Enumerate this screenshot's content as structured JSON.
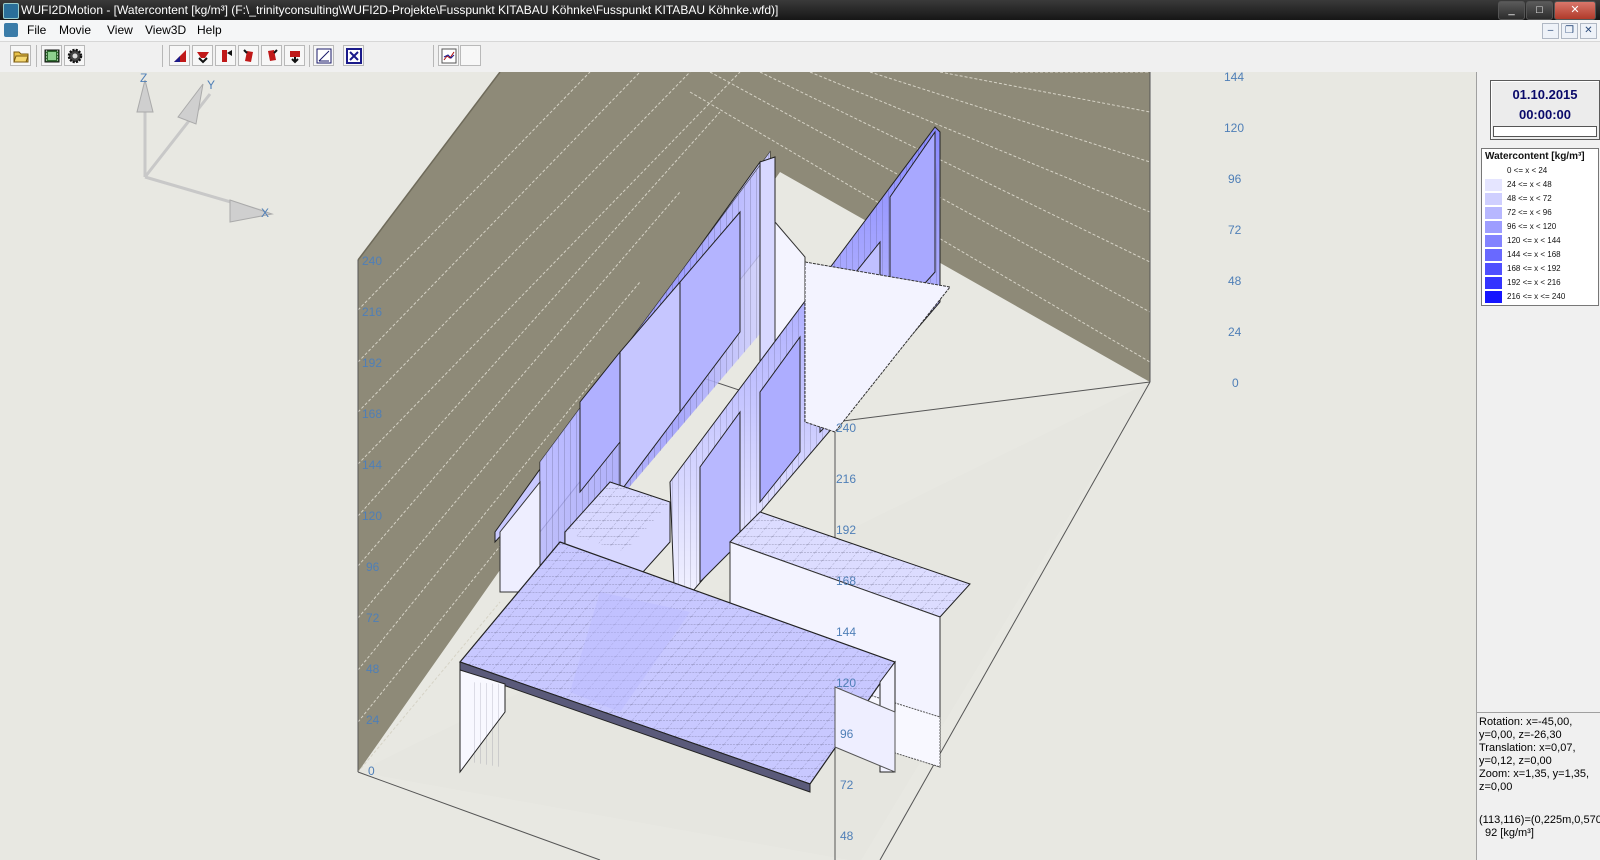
{
  "window": {
    "title": "WUFI2DMotion - [Watercontent [kg/m³] (F:\\_trinityconsulting\\WUFI2D-Projekte\\Fusspunkt KITABAU Köhnke\\Fusspunkt KITABAU Köhnke.wfd)]",
    "minimize": "_",
    "maximize": "□",
    "close": "✕"
  },
  "menu": [
    {
      "label": "File"
    },
    {
      "label": "Movie"
    },
    {
      "label": "View"
    },
    {
      "label": "View3D"
    },
    {
      "label": "Help"
    }
  ],
  "mdi": {
    "minimize": "–",
    "restore": "❐",
    "close": "✕"
  },
  "toolbar": [
    {
      "icon": "folder-open-icon"
    },
    {
      "icon": "film-icon"
    },
    {
      "icon": "gear-icon"
    },
    {
      "icon": "rotate-x-icon"
    },
    {
      "icon": "rotate-y-icon"
    },
    {
      "icon": "rotate-z-icon"
    },
    {
      "icon": "tilt-left-icon"
    },
    {
      "icon": "tilt-right-icon"
    },
    {
      "icon": "tilt-down-icon"
    },
    {
      "icon": "perspective-icon"
    },
    {
      "icon": "fit-view-icon"
    },
    {
      "icon": "chart-icon"
    }
  ],
  "viewport": {
    "axes": {
      "z": "Z",
      "y": "Y",
      "x": "X"
    },
    "left_axis_ticks": [
      "0",
      "24",
      "48",
      "72",
      "96",
      "120",
      "144",
      "168",
      "192",
      "216",
      "240"
    ],
    "right_axis_ticks": [
      "0",
      "24",
      "48",
      "72",
      "96",
      "120",
      "144"
    ],
    "front_axis_ticks": [
      "48",
      "72",
      "96",
      "120",
      "144",
      "168",
      "192",
      "216",
      "240"
    ],
    "colors": {
      "background": "#e8e8e2",
      "wall": "#8e8a78",
      "gridline": "#d6d3c6",
      "mesh_dark": "#333344",
      "mesh_fill": "#9f9fff",
      "ticks": "#4f7fb7"
    }
  },
  "clock": {
    "date": "01.10.2015",
    "time": "00:00:00",
    "progress": 0.0
  },
  "legend": {
    "title": "Watercontent [kg/m³]",
    "items": [
      {
        "label": "0 <= x < 24",
        "color": "#ffffff"
      },
      {
        "label": "24 <= x < 48",
        "color": "#e5e5ff"
      },
      {
        "label": "48 <= x < 72",
        "color": "#cfcfff"
      },
      {
        "label": "72 <= x < 96",
        "color": "#b7b7ff"
      },
      {
        "label": "96 <= x < 120",
        "color": "#9d9dff"
      },
      {
        "label": "120 <= x < 144",
        "color": "#8383ff"
      },
      {
        "label": "144 <= x < 168",
        "color": "#6969ff"
      },
      {
        "label": "168 <= x < 192",
        "color": "#4f4fff"
      },
      {
        "label": "192 <= x < 216",
        "color": "#3434ff"
      },
      {
        "label": "216 <= x <= 240",
        "color": "#1515ff"
      }
    ]
  },
  "info": {
    "lines": [
      "Rotation: x=-45,00,",
      "y=0,00, z=-26,30",
      "Translation: x=0,07,",
      "y=0,12, z=0,00",
      "Zoom: x=1,35, y=1,35,",
      "z=0,00"
    ],
    "pick_line1": "(113,116)=(0,225m,0,570",
    "pick_line2": "92 [kg/m³]"
  }
}
